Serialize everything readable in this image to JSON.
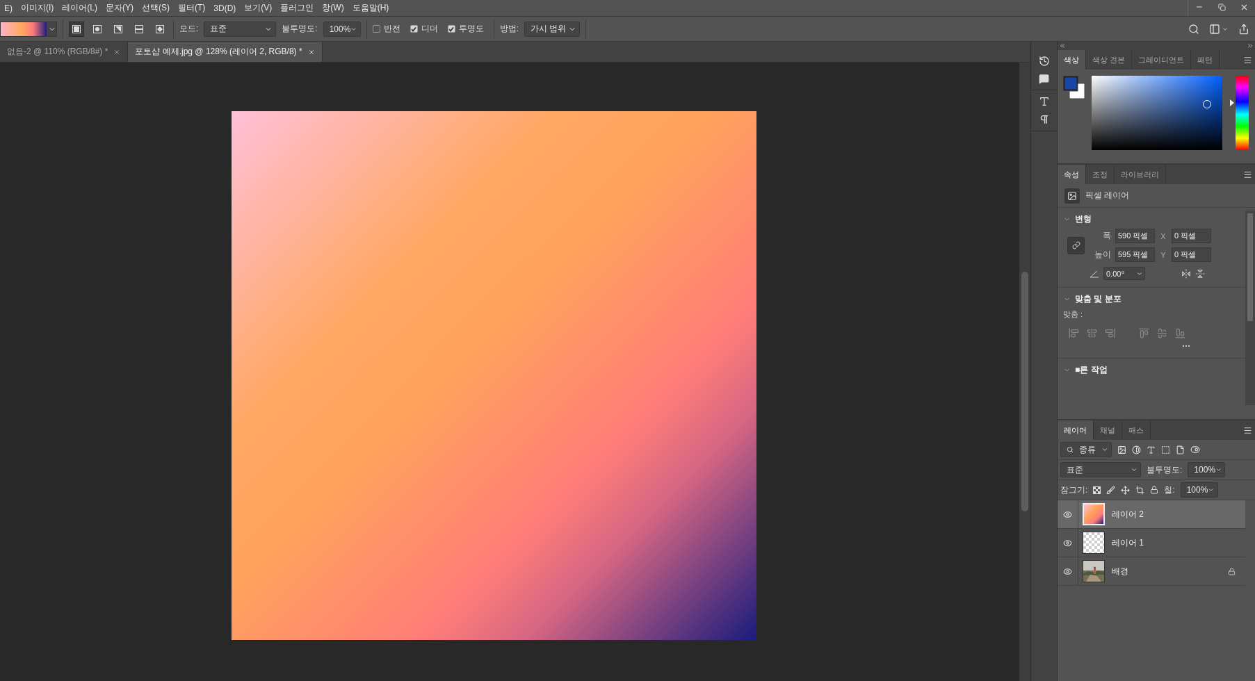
{
  "menu": [
    "E)",
    "이미지(I)",
    "레이어(L)",
    "문자(Y)",
    "선택(S)",
    "필터(T)",
    "3D(D)",
    "보기(V)",
    "플러그인",
    "창(W)",
    "도움말(H)"
  ],
  "options_bar": {
    "gradient_types": [
      {
        "kind": "linear",
        "selected": true
      },
      {
        "kind": "radial",
        "selected": false
      },
      {
        "kind": "angle",
        "selected": false
      },
      {
        "kind": "reflected",
        "selected": false
      },
      {
        "kind": "diamond",
        "selected": false
      }
    ],
    "mode_label": "모드:",
    "mode": "표준",
    "opacity_label": "불투명도:",
    "opacity": "100%",
    "checkboxes": [
      {
        "label": "반전",
        "checked": false
      },
      {
        "label": "디더",
        "checked": true
      },
      {
        "label": "투명도",
        "checked": true
      }
    ],
    "method_label": "방법:",
    "method": "가시 범위"
  },
  "doc_tabs": [
    {
      "title": "없음-2 @ 110% (RGB/8#) *",
      "selected": false
    },
    {
      "title": "포토샵 예제.jpg @ 128% (레이어 2, RGB/8) *",
      "selected": true
    }
  ],
  "color_panel": {
    "tabs": [
      {
        "label": "색상",
        "selected": true
      },
      {
        "label": "색상 견본",
        "selected": false
      },
      {
        "label": "그레이디언트",
        "selected": false
      },
      {
        "label": "패턴",
        "selected": false
      }
    ],
    "swatches": [
      {
        "kind": "foreground",
        "color": "#1746a4"
      },
      {
        "kind": "background",
        "color": "#ffffff"
      }
    ],
    "hue": {
      "level": 0.36
    }
  },
  "properties_panel": {
    "tabs": [
      {
        "label": "속성",
        "selected": true
      },
      {
        "label": "조정",
        "selected": false
      },
      {
        "label": "라이브러리",
        "selected": false
      }
    ],
    "layer_type": "픽셀 레이어",
    "transform": {
      "title": "변형",
      "expanded": true,
      "width_label": "폭",
      "width": "590 픽셀",
      "x_label": "X",
      "x": "0 픽셀",
      "height_label": "높이",
      "height": "595 픽셀",
      "y_label": "Y",
      "y": "0 픽셀",
      "angle": "0.00°"
    },
    "align": {
      "title": "맞춤 및 분포",
      "expanded": true,
      "label": "맞춤 :"
    },
    "quick_actions": {
      "title": "■른 작업",
      "expanded": true
    }
  },
  "layers_panel": {
    "tabs": [
      {
        "label": "레이어",
        "selected": true
      },
      {
        "label": "채널",
        "selected": false
      },
      {
        "label": "패스",
        "selected": false
      }
    ],
    "filter": "종류",
    "blend_mode": "표준",
    "opacity_label": "불투명도:",
    "opacity": "100%",
    "lock_label": "잠그기:",
    "fill_label": "칠:",
    "fill": "100%",
    "layers": [
      {
        "name": "레이어 2",
        "kind": "gradient",
        "visible": true,
        "selected": true,
        "locked": false
      },
      {
        "name": "레이어 1",
        "kind": "transparent",
        "visible": true,
        "selected": false,
        "locked": false
      },
      {
        "name": "배경",
        "visible": true,
        "selected": false,
        "locked": true
      }
    ]
  }
}
